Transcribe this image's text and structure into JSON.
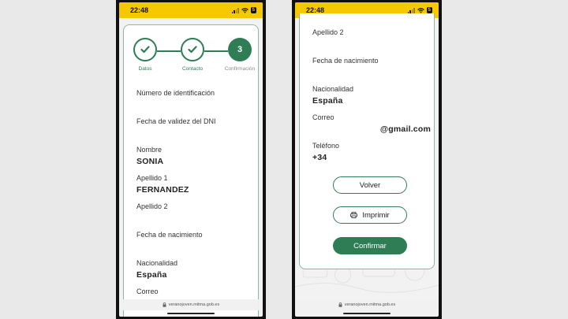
{
  "status": {
    "time": "22:48",
    "battery": "5"
  },
  "url": "veranojoven.mitma.gob.es",
  "stepper": {
    "steps": [
      {
        "label": "Datos",
        "state": "done"
      },
      {
        "label": "Contacto",
        "state": "done"
      },
      {
        "label": "Confirmación",
        "number": "3",
        "state": "current"
      }
    ]
  },
  "left_fields": {
    "id_label": "Número de identificación",
    "dni_validity_label": "Fecha de validez del DNI",
    "name_label": "Nombre",
    "name_value": "SONIA",
    "surname1_label": "Apellido 1",
    "surname1_value": "FERNANDEZ",
    "surname2_label": "Apellido 2",
    "birthdate_label": "Fecha de nacimiento",
    "nationality_label": "Nacionalidad",
    "nationality_value": "España",
    "email_label": "Correo"
  },
  "right_fields": {
    "surname2_label": "Apellido 2",
    "birthdate_label": "Fecha de nacimiento",
    "nationality_label": "Nacionalidad",
    "nationality_value": "España",
    "email_label": "Correo",
    "email_value": "@gmail.com",
    "phone_label": "Teléfono",
    "phone_value": "+34"
  },
  "buttons": {
    "back": "Volver",
    "print": "Imprimir",
    "confirm": "Confirmar"
  },
  "colors": {
    "accent": "#2e7d55",
    "status_bar": "#f5c800"
  }
}
